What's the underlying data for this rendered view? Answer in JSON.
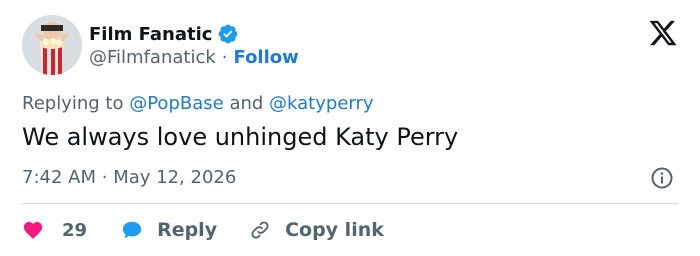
{
  "tweet": {
    "display_name": "Film Fanatic",
    "handle": "@Filmfanatick",
    "separator": "·",
    "follow_label": "Follow",
    "replying_prefix": "Replying to",
    "reply_targets": [
      "@PopBase",
      "@katyperry"
    ],
    "reply_joiner": "and",
    "text": "We always love unhinged Katy Perry",
    "time": "7:42 AM",
    "date": "May 12, 2026",
    "like_count": "29",
    "reply_label": "Reply",
    "copy_link_label": "Copy link"
  },
  "icons": {
    "verified": "verified-badge-icon",
    "platform": "x-logo-icon",
    "info": "info-icon",
    "like": "heart-icon",
    "reply": "speech-bubble-icon",
    "link": "link-icon"
  },
  "colors": {
    "accent": "#1d7bd8",
    "verified": "#1d9bf0",
    "like": "#f91880",
    "muted": "#536471",
    "text": "#0f1419"
  }
}
